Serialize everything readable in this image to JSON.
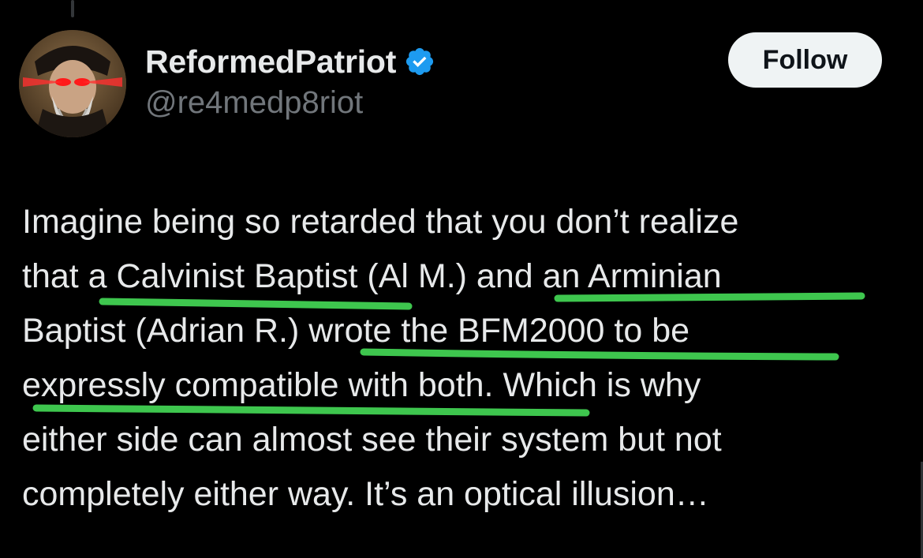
{
  "user": {
    "display_name": "ReformedPatriot",
    "handle": "@re4medp8riot",
    "verified": true,
    "verified_icon": "verified-badge-icon",
    "avatar": "avatar-image"
  },
  "follow_button": {
    "label": "Follow"
  },
  "tweet": {
    "lines": [
      "Imagine being so retarded that you don’t realize",
      "that a Calvinist Baptist (Al M.) and  an Arminian",
      "Baptist (Adrian R.) wrote the BFM2000 to be",
      "expressly compatible with both. Which is why",
      "either side can almost see their system but not",
      "completely either way. It’s an optical illusion…"
    ]
  },
  "colors": {
    "background": "#000000",
    "text": "#e7e9ea",
    "secondary_text": "#71767b",
    "verified_blue": "#1d9bf0",
    "underline_green": "#3ec64e",
    "follow_button_bg": "#eff3f4"
  }
}
